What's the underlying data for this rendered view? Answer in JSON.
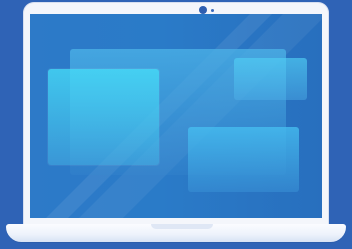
{
  "illustration": {
    "device": "laptop",
    "icons": {
      "camera": "camera-icon",
      "laptop": "laptop-icon"
    },
    "colors": {
      "background": "#2f63b6",
      "laptop_frame": "#f4f6fb",
      "screen": "#2a7bc8",
      "panel_highlight": "#46ddf8",
      "camera": "#2f5fb0"
    }
  }
}
